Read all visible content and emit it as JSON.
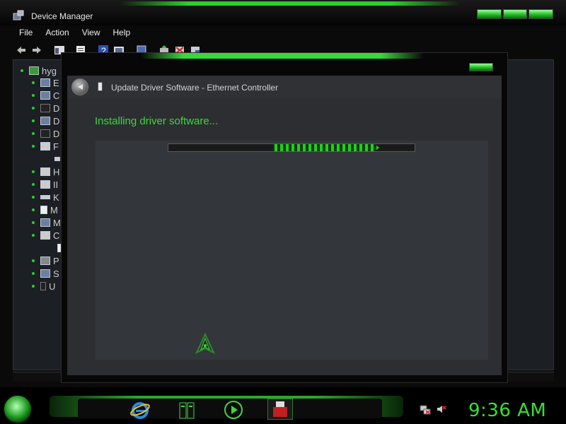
{
  "device_manager": {
    "title": "Device Manager",
    "menu": [
      "File",
      "Action",
      "View",
      "Help"
    ],
    "tree": {
      "root_label": "hyg",
      "children": [
        "E",
        "C",
        "D",
        "D",
        "D",
        "F",
        "",
        "H",
        "II",
        "K",
        "M",
        "M",
        "C",
        "",
        "P",
        "S",
        "U"
      ]
    }
  },
  "dialog": {
    "title": "Update Driver Software - Ethernet Controller",
    "status_text": "Installing driver software..."
  },
  "taskbar": {
    "clock": "9:36 AM"
  },
  "colors": {
    "accent_green": "#2bd12b",
    "status_text_green": "#3fd63f",
    "clock_green": "#35e135"
  }
}
